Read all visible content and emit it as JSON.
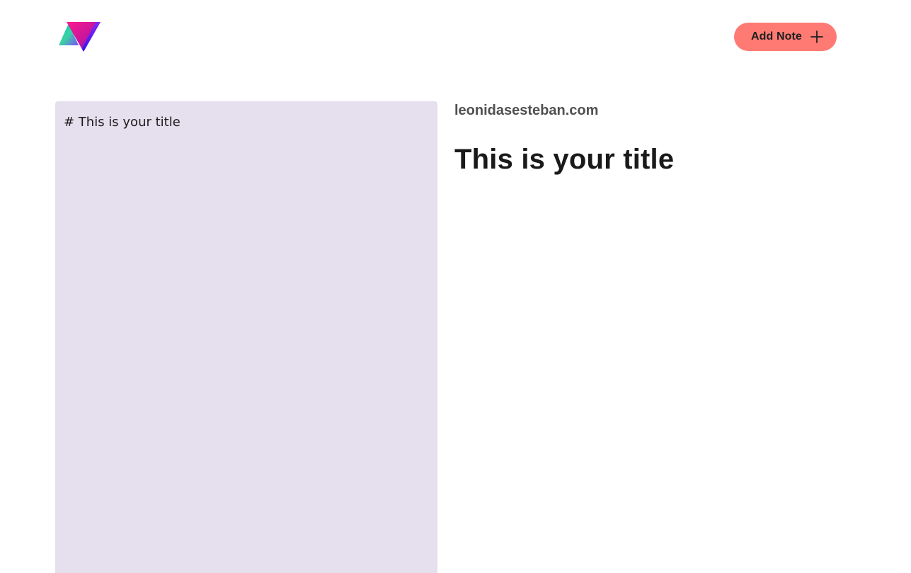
{
  "header": {
    "logo_icon": "triangle-prism-logo",
    "add_note_label": "Add Note",
    "add_note_icon": "plus-icon"
  },
  "editor": {
    "content": "# This is your title"
  },
  "preview": {
    "site_domain": "leonidasesteban.com",
    "title": "This is your title"
  },
  "colors": {
    "button_bg": "#ff7a73",
    "editor_bg": "#e5dfee",
    "text_dark": "#1a1a1a",
    "domain_text": "#505050"
  }
}
